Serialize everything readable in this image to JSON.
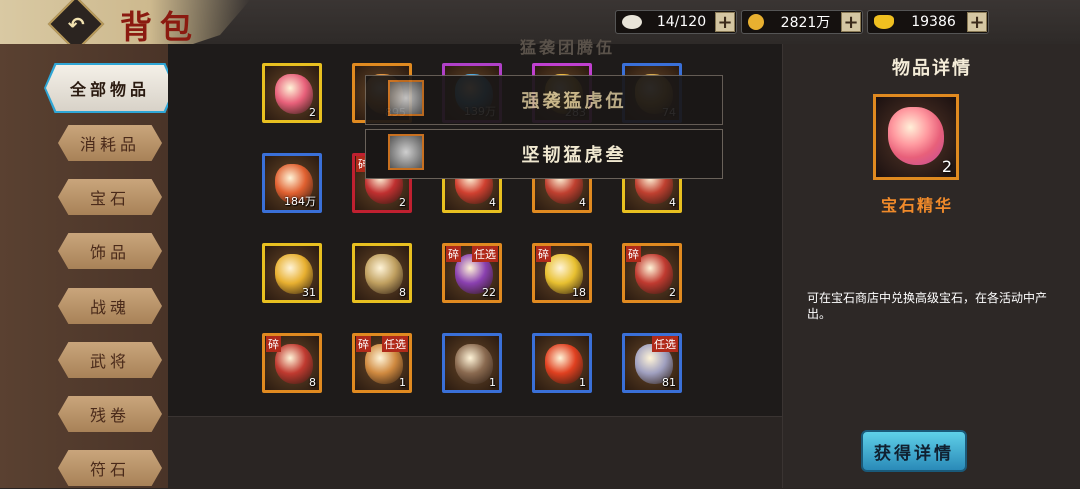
{
  "header": {
    "title": "背包",
    "back_icon": "back-arrow-icon",
    "resources": [
      {
        "name": "rice-ball",
        "value": "14/120",
        "color": "#e8e4d8"
      },
      {
        "name": "copper-coin",
        "value": "2821万",
        "color": "#e8b030"
      },
      {
        "name": "gold-ingot",
        "value": "19386",
        "color": "#f0c020"
      }
    ],
    "plus_label": "+"
  },
  "sidebar": {
    "tabs": [
      {
        "label": "全部物品",
        "active": true
      },
      {
        "label": "消耗品"
      },
      {
        "label": "宝石"
      },
      {
        "label": "饰品"
      },
      {
        "label": "战魂"
      },
      {
        "label": "武将"
      },
      {
        "label": "残卷"
      },
      {
        "label": "符石"
      }
    ]
  },
  "items": [
    {
      "count": "2",
      "color": "#e8607a",
      "border": "#e8c020",
      "icon": "gem-essence-icon"
    },
    {
      "count": "895",
      "color": "#e08a30",
      "border": "#e08a20",
      "icon": "orange-pouch-icon"
    },
    {
      "count": "139万",
      "color": "#3aa0e0",
      "border": "#b040c8",
      "icon": "blue-egg-icon"
    },
    {
      "count": "283",
      "color": "#e8b030",
      "border": "#c040d0",
      "icon": "coin-medal-icon"
    },
    {
      "count": "74",
      "color": "#d0a040",
      "border": "#3a70d8",
      "icon": "scroll-badge-icon"
    },
    {
      "count": "184万",
      "color": "#e06030",
      "border": "#3a70d8",
      "icon": "red-token-icon"
    },
    {
      "count": "2",
      "color": "#c03030",
      "border": "#c02030",
      "icon": "red-chest-icon",
      "tag_left": "碎"
    },
    {
      "count": "4",
      "color": "#d04030",
      "border": "#e8c020",
      "icon": "red-chest-icon"
    },
    {
      "count": "4",
      "color": "#c04030",
      "border": "#e08a20",
      "icon": "red-chest-icon"
    },
    {
      "count": "4",
      "color": "#c04030",
      "border": "#e8c020",
      "icon": "red-chest-icon"
    },
    {
      "count": "31",
      "color": "#e8b030",
      "border": "#e8c020",
      "icon": "gold-chest-icon"
    },
    {
      "count": "8",
      "color": "#c0a060",
      "border": "#e8c020",
      "icon": "gold-pile-chest-icon"
    },
    {
      "count": "22",
      "color": "#8a40b0",
      "border": "#e08a20",
      "icon": "purple-box-icon",
      "tag_left": "碎",
      "tag_right": "任选"
    },
    {
      "count": "18",
      "color": "#e8c030",
      "border": "#e08a20",
      "icon": "gold-box-icon",
      "tag_left": "碎"
    },
    {
      "count": "2",
      "color": "#c03a30",
      "border": "#e08a20",
      "icon": "red-chest-icon",
      "tag_left": "碎"
    },
    {
      "count": "8",
      "color": "#c03a30",
      "border": "#e08a20",
      "icon": "red-chest-icon",
      "tag_left": "碎"
    },
    {
      "count": "1",
      "color": "#d08a40",
      "border": "#e08a20",
      "icon": "gold-chest-icon",
      "tag_left": "碎",
      "tag_right": "任选"
    },
    {
      "count": "1",
      "color": "#8a6a50",
      "border": "#3a70d8",
      "icon": "skull-chest-icon"
    },
    {
      "count": "1",
      "color": "#e04020",
      "border": "#3a70d8",
      "icon": "lucky-bag-icon"
    },
    {
      "count": "81",
      "color": "#a0a0c0",
      "border": "#3a70d8",
      "icon": "silver-chest-icon",
      "tag_right": "任选"
    }
  ],
  "popups": [
    {
      "label": "强袭猛虎伍",
      "icon": "tiger-head-icon"
    },
    {
      "label": "坚韧猛虎叁",
      "icon": "tiger-head-icon"
    }
  ],
  "background_popup": {
    "label": "猛袭团腾伍"
  },
  "detail": {
    "title": "物品详情",
    "item_name": "宝石精华",
    "item_count": "2",
    "icon": "gem-essence-icon",
    "description": "可在宝石商店中兑换高级宝石，在各活动中产出。",
    "button_label": "获得详情"
  }
}
